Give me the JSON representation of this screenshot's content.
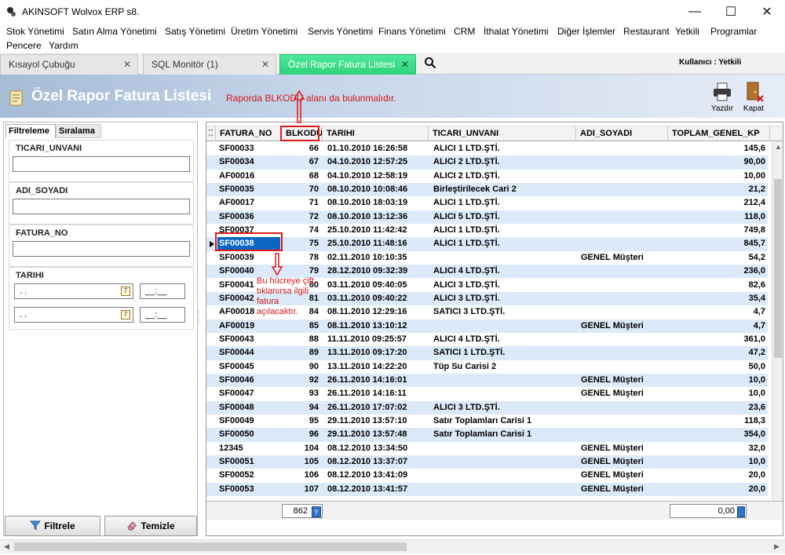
{
  "window": {
    "title": "AKINSOFT Wolvox ERP s8.",
    "controls": [
      "—",
      "☐",
      "✕"
    ]
  },
  "menu": {
    "row1": [
      "Stok Yönetimi",
      "Satın Alma Yönetimi",
      "Satış Yönetimi",
      "Üretim Yönetimi",
      "Servis Yönetimi",
      "Finans Yönetimi",
      "CRM",
      "İthalat Yönetimi",
      "Diğer İşlemler",
      "Restaurant",
      "Yetkili",
      "Programlar"
    ],
    "row2": [
      "Pencere",
      "Yardım"
    ]
  },
  "tabs": [
    {
      "label": "Kısayol Çubuğu",
      "close": "✕"
    },
    {
      "label": "SQL Monitör (1)",
      "close": "✕"
    },
    {
      "label": "Özel Rapor Fatura Listesi",
      "close": "✕"
    }
  ],
  "user_label": "Kullanıcı : Yetkili",
  "header": {
    "title": "Özel Rapor Fatura Listesi",
    "annotation": "Raporda BLKODU alanı da bulunmalıdır.",
    "print_label": "Yazdır",
    "close_label": "Kapat"
  },
  "filter_panel": {
    "tab_filter": "Filtreleme",
    "tab_sort": "Sıralama",
    "groups": {
      "ticari": {
        "label": "TICARI_UNVANI",
        "value": ""
      },
      "adi": {
        "label": "ADI_SOYADI",
        "value": ""
      },
      "fatura": {
        "label": "FATURA_NO",
        "value": ""
      },
      "tarih": {
        "label": "TARIHI",
        "date1": " .  .",
        "time1": "__:__",
        "date2": " .  .",
        "time2": "__:__",
        "cal_glyph": "7"
      }
    },
    "filter_button": "Filtrele",
    "clear_button": "Temizle"
  },
  "grid": {
    "columns": [
      "FATURA_NO",
      "BLKODU",
      "TARIHI",
      "TICARI_UNVANI",
      "ADI_SOYADI",
      "TOPLAM_GENEL_KP"
    ],
    "rows": [
      [
        "SF00033",
        "66",
        "01.10.2010 16:26:58",
        "ALICI 1 LTD.ŞTİ.",
        "",
        "145,6"
      ],
      [
        "SF00034",
        "67",
        "04.10.2010 12:57:25",
        "ALICI 2 LTD.ŞTİ.",
        "",
        "90,00"
      ],
      [
        "AF00016",
        "68",
        "04.10.2010 12:58:19",
        "ALICI 2 LTD.ŞTİ.",
        "",
        "10,00"
      ],
      [
        "SF00035",
        "70",
        "08.10.2010 10:08:46",
        "Birleştirilecek Cari 2",
        "",
        "21,2"
      ],
      [
        "AF00017",
        "71",
        "08.10.2010 18:03:19",
        "ALICI 1 LTD.ŞTİ.",
        "",
        "212,4"
      ],
      [
        "SF00036",
        "72",
        "08.10.2010 13:12:36",
        "ALICI 5 LTD.ŞTİ.",
        "",
        "118,0"
      ],
      [
        "SF00037",
        "74",
        "25.10.2010 11:42:42",
        "ALICI 1 LTD.ŞTİ.",
        "",
        "749,8"
      ],
      [
        "SF00038",
        "75",
        "25.10.2010 11:48:16",
        "ALICI 1 LTD.ŞTİ.",
        "",
        "845,7"
      ],
      [
        "SF00039",
        "78",
        "02.11.2010 10:10:35",
        "",
        "GENEL Müşteri",
        "54,2"
      ],
      [
        "SF00040",
        "79",
        "28.12.2010 09:32:39",
        "ALICI 4 LTD.ŞTİ.",
        "",
        "236,0"
      ],
      [
        "SF00041",
        "80",
        "03.11.2010 09:40:05",
        "ALICI 3 LTD.ŞTİ.",
        "",
        "82,6"
      ],
      [
        "SF00042",
        "81",
        "03.11.2010 09:40:22",
        "ALICI 3 LTD.ŞTİ.",
        "",
        "35,4"
      ],
      [
        "AF00018",
        "84",
        "08.11.2010 12:29:16",
        "SATICI 3 LTD.ŞTİ.",
        "",
        "4,7"
      ],
      [
        "AF00019",
        "85",
        "08.11.2010 13:10:12",
        "",
        "GENEL Müşteri",
        "4,7"
      ],
      [
        "SF00043",
        "88",
        "11.11.2010 09:25:57",
        "ALICI 4 LTD.ŞTİ.",
        "",
        "361,0"
      ],
      [
        "SF00044",
        "89",
        "13.11.2010 09:17:20",
        "SATICI 1 LTD.ŞTİ.",
        "",
        "47,2"
      ],
      [
        "SF00045",
        "90",
        "13.11.2010 14:22:20",
        "Tüp Su Carisi 2",
        "",
        "50,0"
      ],
      [
        "SF00046",
        "92",
        "26.11.2010 14:16:01",
        "",
        "GENEL Müşteri",
        "10,0"
      ],
      [
        "SF00047",
        "93",
        "26.11.2010 14:16:11",
        "",
        "GENEL Müşteri",
        "10,0"
      ],
      [
        "SF00048",
        "94",
        "26.11.2010 17:07:02",
        "ALICI 3 LTD.ŞTİ.",
        "",
        "23,6"
      ],
      [
        "SF00049",
        "95",
        "29.11.2010 13:57:10",
        "Satır Toplamları Carisi 1",
        "",
        "118,3"
      ],
      [
        "SF00050",
        "96",
        "29.11.2010 13:57:48",
        "Satır Toplamları Carisi 1",
        "",
        "354,0"
      ],
      [
        "12345",
        "104",
        "08.12.2010 13:34:50",
        "",
        "GENEL Müşteri",
        "32,0"
      ],
      [
        "SF00051",
        "105",
        "08.12.2010 13:37:07",
        "",
        "GENEL Müşteri",
        "10,0"
      ],
      [
        "SF00052",
        "106",
        "08.12.2010 13:41:09",
        "",
        "GENEL Müşteri",
        "20,0"
      ],
      [
        "SF00053",
        "107",
        "08.12.2010 13:41:57",
        "",
        "GENEL Müşteri",
        "20,0"
      ]
    ],
    "selected_row": 7,
    "footer_blkodu": "862",
    "footer_total": "0,00"
  },
  "annotations": {
    "side_note": "Bu hücreye çift tıklanırsa ilgili fatura açılacaktır."
  },
  "colors": {
    "active_tab": "#2fd37c",
    "row_alt": "#dce9f8",
    "selected": "#0c66c2",
    "annotation_red": "#e01818"
  },
  "icons": [
    "app-icon",
    "search-icon",
    "doc-icon",
    "printer-icon",
    "exit-icon",
    "funnel-icon",
    "eraser-icon",
    "calendar-icon",
    "calculator-icon"
  ]
}
